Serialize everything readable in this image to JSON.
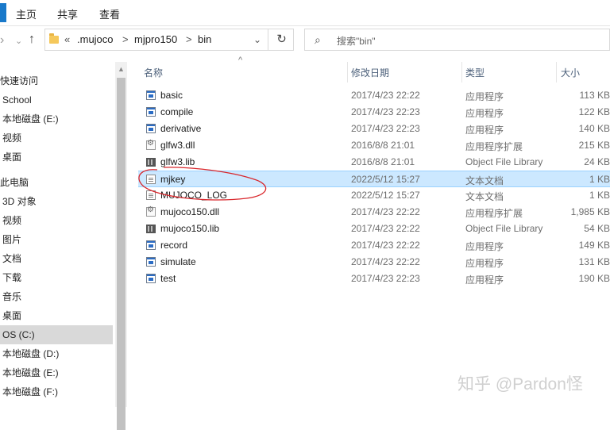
{
  "ribbon": {
    "tabs": [
      "主页",
      "共享",
      "查看"
    ]
  },
  "address": {
    "prefix": "«",
    "segments": [
      ".mujoco",
      "mjpro150",
      "bin"
    ],
    "separator": ">",
    "dropdown_icon": "chevron-down-icon",
    "refresh_icon": "refresh-icon"
  },
  "search": {
    "placeholder": "搜索\"bin\"",
    "icon": "search-icon"
  },
  "sidebar": {
    "items": [
      {
        "label": "快速访问",
        "flush": true
      },
      {
        "label": "School"
      },
      {
        "label": "本地磁盘 (E:)"
      },
      {
        "label": "视频"
      },
      {
        "label": "桌面"
      },
      {
        "label": "此电脑",
        "flush": true
      },
      {
        "label": "3D 对象"
      },
      {
        "label": "视频"
      },
      {
        "label": "图片"
      },
      {
        "label": "文档"
      },
      {
        "label": "下载"
      },
      {
        "label": "音乐"
      },
      {
        "label": "桌面"
      },
      {
        "label": "OS (C:)",
        "selected": true
      },
      {
        "label": "本地磁盘 (D:)"
      },
      {
        "label": "本地磁盘 (E:)"
      },
      {
        "label": "本地磁盘 (F:)"
      }
    ]
  },
  "columns": {
    "name": "名称",
    "date": "修改日期",
    "type": "类型",
    "size": "大小"
  },
  "files": [
    {
      "name": "basic",
      "date": "2017/4/23 22:22",
      "type": "应用程序",
      "size": "113 KB",
      "icon": "app"
    },
    {
      "name": "compile",
      "date": "2017/4/23 22:23",
      "type": "应用程序",
      "size": "122 KB",
      "icon": "app"
    },
    {
      "name": "derivative",
      "date": "2017/4/23 22:23",
      "type": "应用程序",
      "size": "140 KB",
      "icon": "app"
    },
    {
      "name": "glfw3.dll",
      "date": "2016/8/8 21:01",
      "type": "应用程序扩展",
      "size": "215 KB",
      "icon": "dll"
    },
    {
      "name": "glfw3.lib",
      "date": "2016/8/8 21:01",
      "type": "Object File Library",
      "size": "24 KB",
      "icon": "lib"
    },
    {
      "name": "mjkey",
      "date": "2022/5/12 15:27",
      "type": "文本文档",
      "size": "1 KB",
      "icon": "txt",
      "selected": true
    },
    {
      "name": "MUJOCO_LOG",
      "date": "2022/5/12 15:27",
      "type": "文本文档",
      "size": "1 KB",
      "icon": "txt"
    },
    {
      "name": "mujoco150.dll",
      "date": "2017/4/23 22:22",
      "type": "应用程序扩展",
      "size": "1,985 KB",
      "icon": "dll"
    },
    {
      "name": "mujoco150.lib",
      "date": "2017/4/23 22:22",
      "type": "Object File Library",
      "size": "54 KB",
      "icon": "lib"
    },
    {
      "name": "record",
      "date": "2017/4/23 22:22",
      "type": "应用程序",
      "size": "149 KB",
      "icon": "app"
    },
    {
      "name": "simulate",
      "date": "2017/4/23 22:22",
      "type": "应用程序",
      "size": "131 KB",
      "icon": "app"
    },
    {
      "name": "test",
      "date": "2017/4/23 22:23",
      "type": "应用程序",
      "size": "190 KB",
      "icon": "app"
    }
  ],
  "watermark": "知乎 @Pardon怪",
  "colors": {
    "selection": "#cce8ff",
    "accent": "#1979ca",
    "annotation": "#d9262b"
  }
}
